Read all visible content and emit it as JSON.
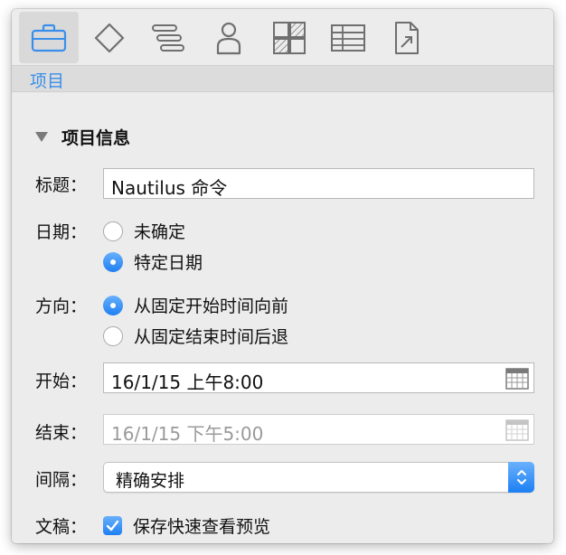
{
  "toolbar": {
    "tabs": [
      {
        "icon": "briefcase-icon",
        "selected": true
      },
      {
        "icon": "diamond-icon",
        "selected": false
      },
      {
        "icon": "gantt-icon",
        "selected": false
      },
      {
        "icon": "person-icon",
        "selected": false
      },
      {
        "icon": "style-grid-icon",
        "selected": false
      },
      {
        "icon": "table-icon",
        "selected": false
      },
      {
        "icon": "export-document-icon",
        "selected": false
      }
    ],
    "active_tab_label": "项目"
  },
  "section": {
    "title": "项目信息"
  },
  "form": {
    "title_label": "标题：",
    "title_value": "Nautilus 命令",
    "date_label": "日期：",
    "date_options": [
      {
        "label": "未确定",
        "checked": false
      },
      {
        "label": "特定日期",
        "checked": true
      }
    ],
    "direction_label": "方向：",
    "direction_options": [
      {
        "label": "从固定开始时间向前",
        "checked": true
      },
      {
        "label": "从固定结束时间后退",
        "checked": false
      }
    ],
    "start_label": "开始：",
    "start_value": "16/1/15 上午8:00",
    "end_label": "结束：",
    "end_value": "16/1/15 下午5:00",
    "granularity_label": "间隔：",
    "granularity_value": "精确安排",
    "draft_label": "文稿：",
    "draft_option": {
      "label": "保存快速查看预览",
      "checked": true
    }
  },
  "colors": {
    "accent": "#2680f2",
    "panel_bg": "#ececec",
    "tab_label": "#3a8eea"
  }
}
